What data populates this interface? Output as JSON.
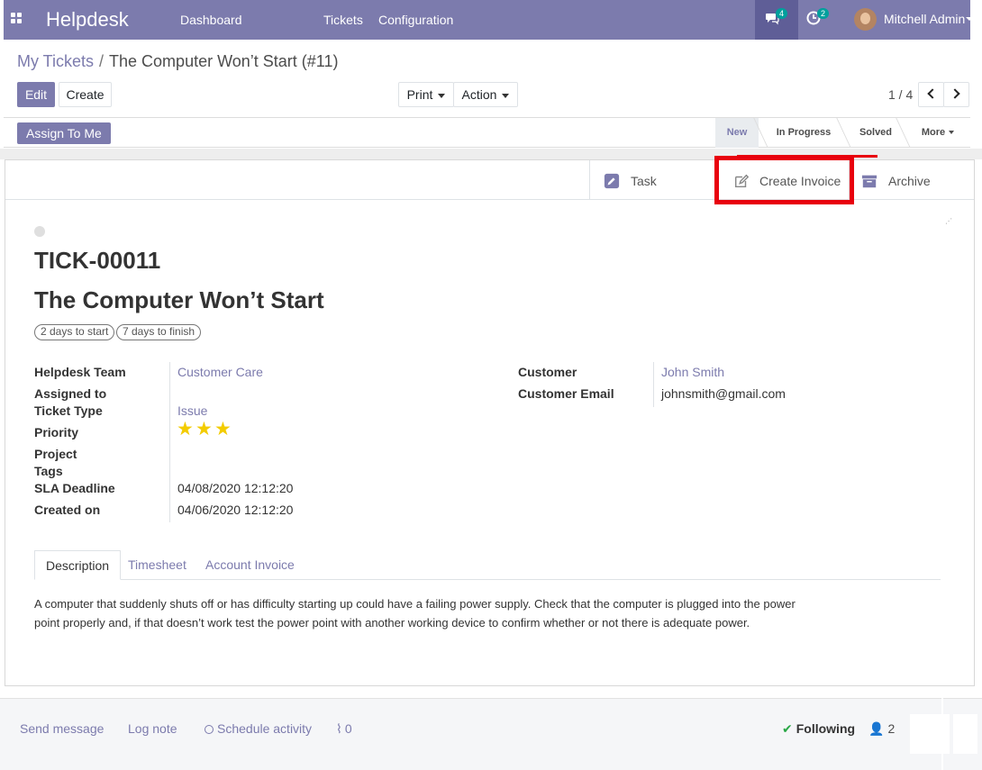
{
  "navbar": {
    "brand": "Helpdesk",
    "menu": [
      "Dashboard",
      "Tickets",
      "Configuration"
    ],
    "messages_count": "4",
    "activities_count": "2",
    "user_name": "Mitchell Admin"
  },
  "breadcrumb": {
    "parent": "My Tickets",
    "separator": "/",
    "current": "The Computer Won’t Start (#11)"
  },
  "toolbar": {
    "edit_label": "Edit",
    "create_label": "Create",
    "print_label": "Print",
    "action_label": "Action",
    "pager": "1 / 4"
  },
  "statusbar": {
    "assign_label": "Assign To Me",
    "stages": [
      "New",
      "In Progress",
      "Solved",
      "More"
    ],
    "active_stage": "New"
  },
  "smart_buttons": {
    "task": "Task",
    "create_invoice": "Create Invoice",
    "archive": "Archive"
  },
  "ticket": {
    "reference": "TICK-00011",
    "title": "The Computer Won’t Start",
    "sla_tags": [
      "2 days to start",
      "7 days to finish"
    ],
    "fields_left": {
      "helpdesk_team_label": "Helpdesk Team",
      "helpdesk_team_value": "Customer Care",
      "assigned_to_label": "Assigned to",
      "ticket_type_label": "Ticket Type",
      "ticket_type_value": "Issue",
      "priority_label": "Priority",
      "priority_stars": 3,
      "project_label": "Project",
      "tags_label": "Tags",
      "sla_deadline_label": "SLA Deadline",
      "sla_deadline_value": "04/08/2020 12:12:20",
      "created_on_label": "Created on",
      "created_on_value": "04/06/2020 12:12:20"
    },
    "fields_right": {
      "customer_label": "Customer",
      "customer_value": "John Smith",
      "customer_email_label": "Customer Email",
      "customer_email_value": "johnsmith@gmail.com"
    }
  },
  "tabs": [
    "Description",
    "Timesheet",
    "Account Invoice"
  ],
  "active_tab": "Description",
  "description": "A computer that suddenly shuts off or has difficulty starting up could have a failing power supply. Check that the computer is plugged into the power point properly and, if that doesn’t work test the power point with another working device to confirm whether or not there is adequate power.",
  "chatter": {
    "send_message": "Send message",
    "log_note": "Log note",
    "schedule_activity": "Schedule activity",
    "attachments_count": "0",
    "following": "Following",
    "followers_count": "2"
  },
  "colors": {
    "brand": "#7c7bad",
    "highlight": "#e8000d",
    "star": "#f3cc00"
  }
}
